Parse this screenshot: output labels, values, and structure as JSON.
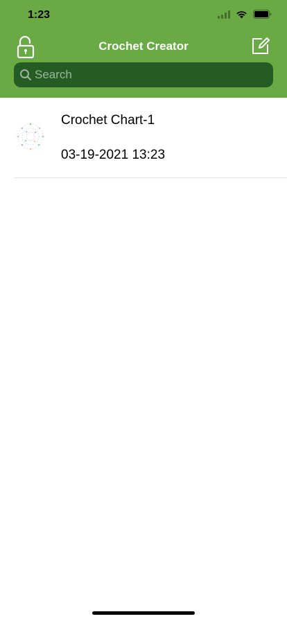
{
  "status_bar": {
    "time": "1:23",
    "icons": [
      "cellular-signal-icon",
      "wifi-icon",
      "battery-icon"
    ]
  },
  "nav": {
    "title": "Crochet Creator",
    "left_icon": "unlock-icon",
    "right_icon": "compose-icon"
  },
  "search": {
    "placeholder": "Search",
    "value": ""
  },
  "charts": [
    {
      "title": "Crochet Chart-1",
      "date": "03-19-2021 13:23",
      "thumbnail_icon": "chart-thumbnail"
    }
  ],
  "colors": {
    "header_bg": "#6aaa44",
    "search_bg": "#245c24",
    "icon_white": "#ffffff",
    "text": "#000000",
    "divider": "#e3e3e3"
  }
}
